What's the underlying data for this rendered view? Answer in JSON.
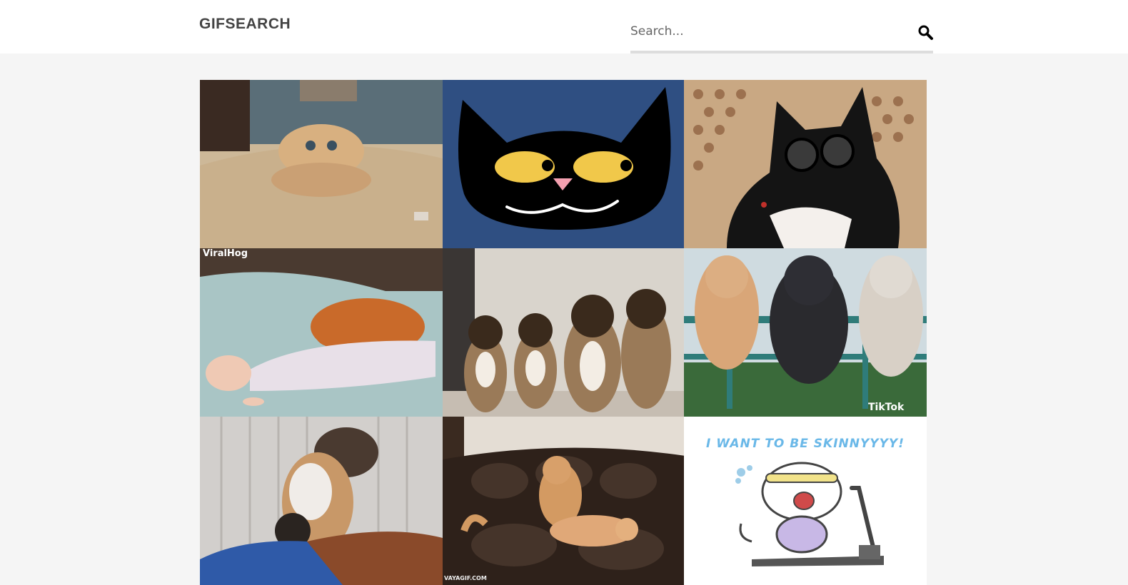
{
  "header": {
    "logo": "GIFSEARCH",
    "search": {
      "placeholder": "Search...",
      "value": "",
      "icon": "search-icon"
    }
  },
  "gifs": [
    {
      "subject": "startled-ginger-cat-on-carpet",
      "watermark": ""
    },
    {
      "subject": "cartoon-black-cat-face",
      "watermark": ""
    },
    {
      "subject": "tuxedo-cat-with-glasses",
      "watermark": ""
    },
    {
      "subject": "cat-and-sleeping-baby",
      "watermark": "ViralHog"
    },
    {
      "subject": "tabby-kittens-looking-up",
      "watermark": ""
    },
    {
      "subject": "three-cats-on-fence",
      "watermark": "TikTok"
    },
    {
      "subject": "cat-falling-off-couch",
      "watermark": ""
    },
    {
      "subject": "cats-playing-on-leather-sofa",
      "watermark": "VAYAGIF.COM"
    },
    {
      "subject": "cartoon-cat-on-treadmill",
      "caption": "I WANT TO BE SKINNYYYY!",
      "watermark": ""
    }
  ]
}
